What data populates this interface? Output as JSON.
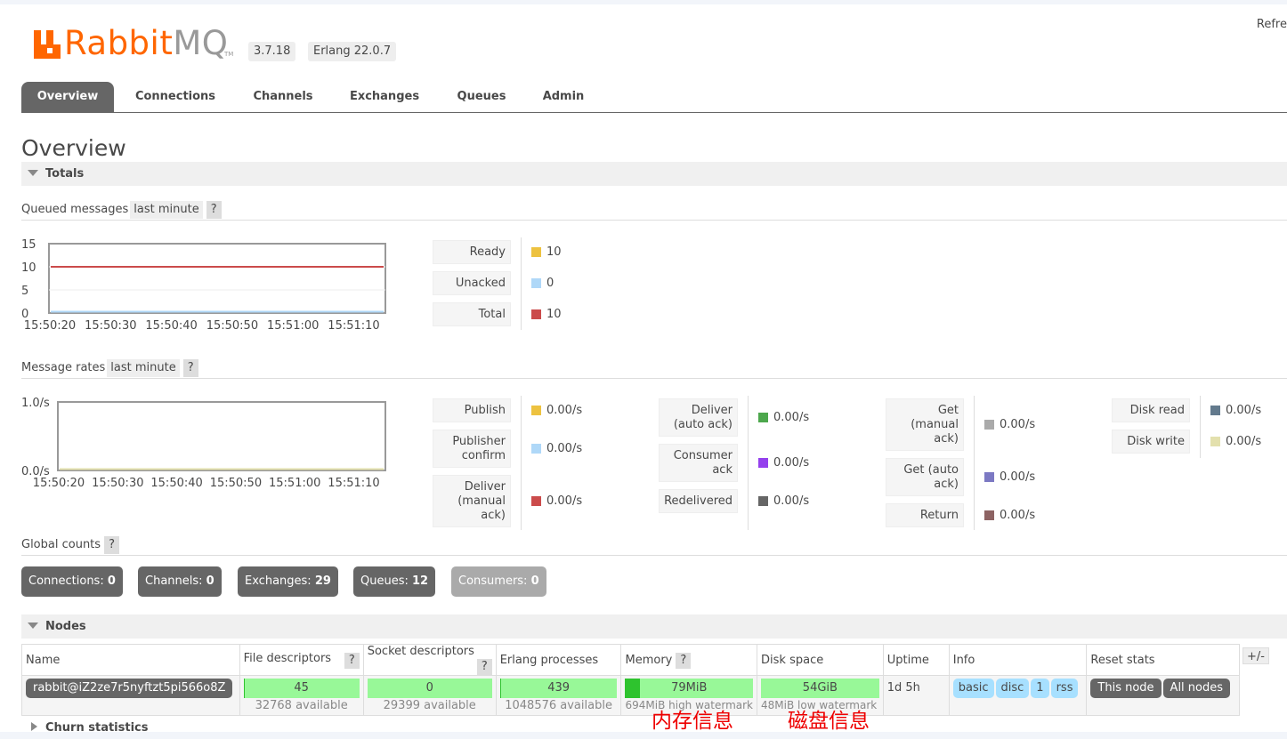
{
  "header": {
    "logo_rabbit": "Rabbit",
    "logo_mq": "MQ",
    "logo_tm": "TM",
    "version": "3.7.18",
    "erlang": "Erlang 22.0.7",
    "refresh": "Refre"
  },
  "tabs": [
    {
      "label": "Overview",
      "active": true
    },
    {
      "label": "Connections"
    },
    {
      "label": "Channels"
    },
    {
      "label": "Exchanges"
    },
    {
      "label": "Queues"
    },
    {
      "label": "Admin"
    }
  ],
  "page_title": "Overview",
  "totals": {
    "title": "Totals",
    "queued": {
      "label": "Queued messages",
      "range": "last minute",
      "help": "?",
      "legend": [
        {
          "label": "Ready",
          "value": "10",
          "color": "#edc240"
        },
        {
          "label": "Unacked",
          "value": "0",
          "color": "#afd8f8"
        },
        {
          "label": "Total",
          "value": "10",
          "color": "#cb4b4b"
        }
      ]
    },
    "rates": {
      "label": "Message rates",
      "range": "last minute",
      "help": "?",
      "legend": [
        {
          "label": "Publish",
          "value": "0.00/s",
          "color": "#edc240"
        },
        {
          "label": "Publisher confirm",
          "value": "0.00/s",
          "color": "#afd8f8"
        },
        {
          "label": "Deliver (manual ack)",
          "value": "0.00/s",
          "color": "#cb4b4b"
        },
        {
          "label": "Deliver (auto ack)",
          "value": "0.00/s",
          "color": "#4da74d"
        },
        {
          "label": "Consumer ack",
          "value": "0.00/s",
          "color": "#9440ed"
        },
        {
          "label": "Redelivered",
          "value": "0.00/s",
          "color": "#666666"
        },
        {
          "label": "Get (manual ack)",
          "value": "0.00/s",
          "color": "#aaaaaa"
        },
        {
          "label": "Get (auto ack)",
          "value": "0.00/s",
          "color": "#7c79c3"
        },
        {
          "label": "Return",
          "value": "0.00/s",
          "color": "#8d6363"
        },
        {
          "label": "Disk read",
          "value": "0.00/s",
          "color": "#637a8d"
        },
        {
          "label": "Disk write",
          "value": "0.00/s",
          "color": "#e3e0ad"
        }
      ]
    },
    "global_counts": {
      "label": "Global counts",
      "help": "?",
      "items": [
        {
          "label": "Connections:",
          "value": "0"
        },
        {
          "label": "Channels:",
          "value": "0"
        },
        {
          "label": "Exchanges:",
          "value": "29"
        },
        {
          "label": "Queues:",
          "value": "12"
        },
        {
          "label": "Consumers:",
          "value": "0"
        }
      ]
    }
  },
  "chart_data": [
    {
      "type": "line",
      "x": [
        "15:50:20",
        "15:50:30",
        "15:50:40",
        "15:50:50",
        "15:51:00",
        "15:51:10"
      ],
      "ylim": [
        0,
        15
      ],
      "yticks": [
        "15",
        "10",
        "5",
        "0"
      ],
      "grid": true,
      "series": [
        {
          "name": "Ready",
          "color": "#edc240",
          "values": [
            10,
            10,
            10,
            10,
            10,
            10
          ]
        },
        {
          "name": "Unacked",
          "color": "#afd8f8",
          "values": [
            0,
            0,
            0,
            0,
            0,
            0
          ]
        },
        {
          "name": "Total",
          "color": "#cb4b4b",
          "values": [
            10,
            10,
            10,
            10,
            10,
            10
          ]
        }
      ]
    },
    {
      "type": "line",
      "x": [
        "15:50:20",
        "15:50:30",
        "15:50:40",
        "15:50:50",
        "15:51:00",
        "15:51:10"
      ],
      "ylim": [
        0,
        1
      ],
      "yticks": [
        "1.0/s",
        "0.0/s"
      ],
      "grid": false,
      "series": [
        {
          "name": "Publish",
          "color": "#edc240",
          "values": [
            0,
            0,
            0,
            0,
            0,
            0
          ]
        },
        {
          "name": "Disk write",
          "color": "#e3e0ad",
          "values": [
            0,
            0,
            0,
            0,
            0,
            0
          ]
        }
      ]
    }
  ],
  "nodes": {
    "title": "Nodes",
    "columns": [
      "Name",
      "File descriptors",
      "Socket descriptors",
      "Erlang processes",
      "Memory",
      "Disk space",
      "Uptime",
      "Info",
      "Reset stats"
    ],
    "help": "?",
    "plusminus": "+/-",
    "row": {
      "name": "rabbit@iZ2ze7r5nyftzt5pi566o8Z",
      "fd": {
        "value": "45",
        "avail": "32768 available",
        "fraction": 0.0014
      },
      "sd": {
        "value": "0",
        "avail": "29399 available",
        "fraction": 0
      },
      "erl": {
        "value": "439",
        "avail": "1048576 available",
        "fraction": 0.0004
      },
      "mem": {
        "value": "79MiB",
        "avail": "694MiB high watermark",
        "fraction": 0.114
      },
      "disk": {
        "value": "54GiB",
        "avail": "48MiB low watermark",
        "fraction": 0
      },
      "uptime": "1d 5h",
      "info": [
        "basic",
        "disc",
        "1",
        "rss"
      ],
      "reset": [
        "This node",
        "All nodes"
      ]
    }
  },
  "annotations": {
    "memory": "内存信息",
    "disk": "磁盘信息"
  },
  "churn": "Churn statistics"
}
